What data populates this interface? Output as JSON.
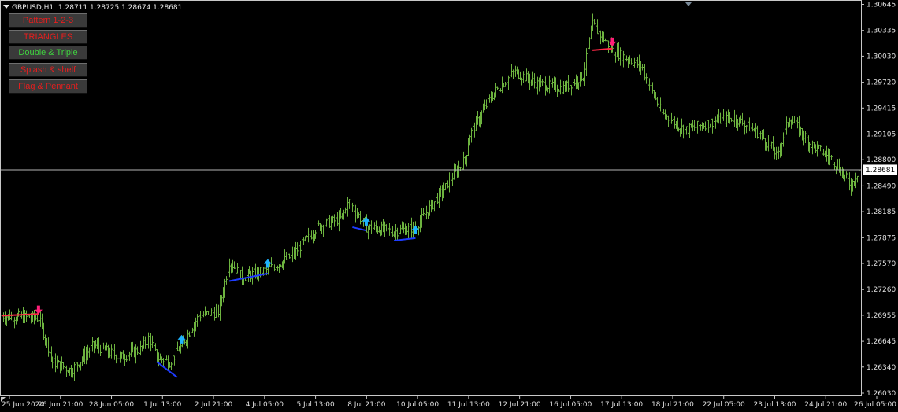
{
  "header": {
    "symbol_timeframe": "GBPUSD,H1",
    "ohlc": "1.28711 1.28725 1.28674 1.28681"
  },
  "buttons": [
    {
      "label": "Pattern 1-2-3",
      "state": "inactive",
      "color": "#e61e1e"
    },
    {
      "label": "TRIANGLES",
      "state": "inactive",
      "color": "#e61e1e"
    },
    {
      "label": "Double & Triple",
      "state": "active",
      "color": "#3fd23f"
    },
    {
      "label": "Splash & shelf",
      "state": "inactive",
      "color": "#e61e1e"
    },
    {
      "label": "Flag & Pennant",
      "state": "inactive",
      "color": "#e61e1e"
    }
  ],
  "price_axis": {
    "ticks": [
      "1.30645",
      "1.30335",
      "1.30030",
      "1.29720",
      "1.29415",
      "1.29105",
      "1.28800",
      "1.28490",
      "1.28185",
      "1.27875",
      "1.27570",
      "1.27260",
      "1.26955",
      "1.26645",
      "1.26340",
      "1.26030"
    ],
    "current_price": "1.28681"
  },
  "time_axis": {
    "ticks": [
      "25 Jun 2024",
      "26 Jun 21:00",
      "28 Jun 05:00",
      "1 Jul 13:00",
      "2 Jul 21:00",
      "4 Jul 05:00",
      "5 Jul 13:00",
      "8 Jul 21:00",
      "10 Jul 05:00",
      "11 Jul 13:00",
      "12 Jul 21:00",
      "16 Jul 05:00",
      "17 Jul 13:00",
      "18 Jul 21:00",
      "22 Jul 05:00",
      "23 Jul 13:00",
      "24 Jul 21:00",
      "26 Jul 05:00"
    ]
  },
  "colors": {
    "background": "#000000",
    "bars": "#6db33f",
    "grid_line": "#b4b4b4",
    "buy_arrow": "#1eb4ff",
    "sell_arrow": "#ff1e78",
    "support_line": "#1e3cff",
    "resistance_line": "#ff2846"
  },
  "chart_data": {
    "type": "ohlc",
    "symbol": "GBPUSD",
    "timeframe": "H1",
    "y_range": [
      1.2603,
      1.30645
    ],
    "close_path": [
      {
        "t": "25 Jun 2024",
        "price": 1.2695
      },
      {
        "t": "26 Jun 00:00",
        "price": 1.2692
      },
      {
        "t": "26 Jun 09:00",
        "price": 1.264
      },
      {
        "t": "26 Jun 21:00",
        "price": 1.263
      },
      {
        "t": "27 Jun 12:00",
        "price": 1.266
      },
      {
        "t": "28 Jun 05:00",
        "price": 1.2645
      },
      {
        "t": "28 Jun 18:00",
        "price": 1.2655
      },
      {
        "t": "1 Jul 00:00",
        "price": 1.267
      },
      {
        "t": "1 Jul 05:00",
        "price": 1.2645
      },
      {
        "t": "1 Jul 13:00",
        "price": 1.264
      },
      {
        "t": "1 Jul 21:00",
        "price": 1.266
      },
      {
        "t": "2 Jul 08:00",
        "price": 1.2695
      },
      {
        "t": "2 Jul 21:00",
        "price": 1.27
      },
      {
        "t": "3 Jul 04:00",
        "price": 1.276
      },
      {
        "t": "3 Jul 12:00",
        "price": 1.274
      },
      {
        "t": "4 Jul 05:00",
        "price": 1.275
      },
      {
        "t": "4 Jul 20:00",
        "price": 1.2765
      },
      {
        "t": "5 Jul 13:00",
        "price": 1.28
      },
      {
        "t": "8 Jul 04:00",
        "price": 1.281
      },
      {
        "t": "8 Jul 10:00",
        "price": 1.283
      },
      {
        "t": "8 Jul 21:00",
        "price": 1.28
      },
      {
        "t": "9 Jul 15:00",
        "price": 1.2795
      },
      {
        "t": "10 Jul 05:00",
        "price": 1.28
      },
      {
        "t": "10 Jul 21:00",
        "price": 1.284
      },
      {
        "t": "11 Jul 13:00",
        "price": 1.288
      },
      {
        "t": "11 Jul 16:00",
        "price": 1.291
      },
      {
        "t": "12 Jul 08:00",
        "price": 1.296
      },
      {
        "t": "12 Jul 21:00",
        "price": 1.2985
      },
      {
        "t": "15 Jul 12:00",
        "price": 1.297
      },
      {
        "t": "16 Jul 05:00",
        "price": 1.2965
      },
      {
        "t": "16 Jul 18:00",
        "price": 1.298
      },
      {
        "t": "17 Jul 00:00",
        "price": 1.304
      },
      {
        "t": "17 Jul 13:00",
        "price": 1.301
      },
      {
        "t": "18 Jul 08:00",
        "price": 1.299
      },
      {
        "t": "18 Jul 21:00",
        "price": 1.2935
      },
      {
        "t": "19 Jul 12:00",
        "price": 1.2915
      },
      {
        "t": "22 Jul 05:00",
        "price": 1.2925
      },
      {
        "t": "22 Jul 20:00",
        "price": 1.293
      },
      {
        "t": "23 Jul 13:00",
        "price": 1.291
      },
      {
        "t": "24 Jul 00:00",
        "price": 1.2885
      },
      {
        "t": "24 Jul 08:00",
        "price": 1.293
      },
      {
        "t": "24 Jul 21:00",
        "price": 1.29
      },
      {
        "t": "25 Jul 12:00",
        "price": 1.288
      },
      {
        "t": "26 Jul 00:00",
        "price": 1.285
      },
      {
        "t": "26 Jul 05:00",
        "price": 1.2868
      }
    ],
    "signals": [
      {
        "type": "sell",
        "t": "26 Jun 00:00",
        "price": 1.2692
      },
      {
        "type": "buy",
        "t": "1 Jul 21:00",
        "price": 1.266
      },
      {
        "type": "buy",
        "t": "4 Jul 05:00",
        "price": 1.275
      },
      {
        "type": "buy",
        "t": "8 Jul 21:00",
        "price": 1.28
      },
      {
        "type": "buy",
        "t": "10 Jul 05:00",
        "price": 1.279
      },
      {
        "type": "sell",
        "t": "17 Jul 13:00",
        "price": 1.301
      }
    ],
    "pattern_lines": [
      {
        "kind": "resistance",
        "t1": "25 Jun 2024",
        "p1": 1.2695,
        "t2": "26 Jun 00:00",
        "p2": 1.2697
      },
      {
        "kind": "support",
        "t1": "1 Jul 05:00",
        "p1": 1.264,
        "t2": "1 Jul 18:00",
        "p2": 1.2622
      },
      {
        "kind": "support",
        "t1": "3 Jul 04:00",
        "p1": 1.2736,
        "t2": "4 Jul 05:00",
        "p2": 1.2745
      },
      {
        "kind": "support",
        "t1": "8 Jul 12:00",
        "p1": 1.28,
        "t2": "8 Jul 21:00",
        "p2": 1.2796
      },
      {
        "kind": "support",
        "t1": "9 Jul 15:00",
        "p1": 1.2784,
        "t2": "10 Jul 05:00",
        "p2": 1.2787
      },
      {
        "kind": "resistance",
        "t1": "17 Jul 00:00",
        "p1": 1.301,
        "t2": "17 Jul 13:00",
        "p2": 1.3012
      }
    ]
  }
}
